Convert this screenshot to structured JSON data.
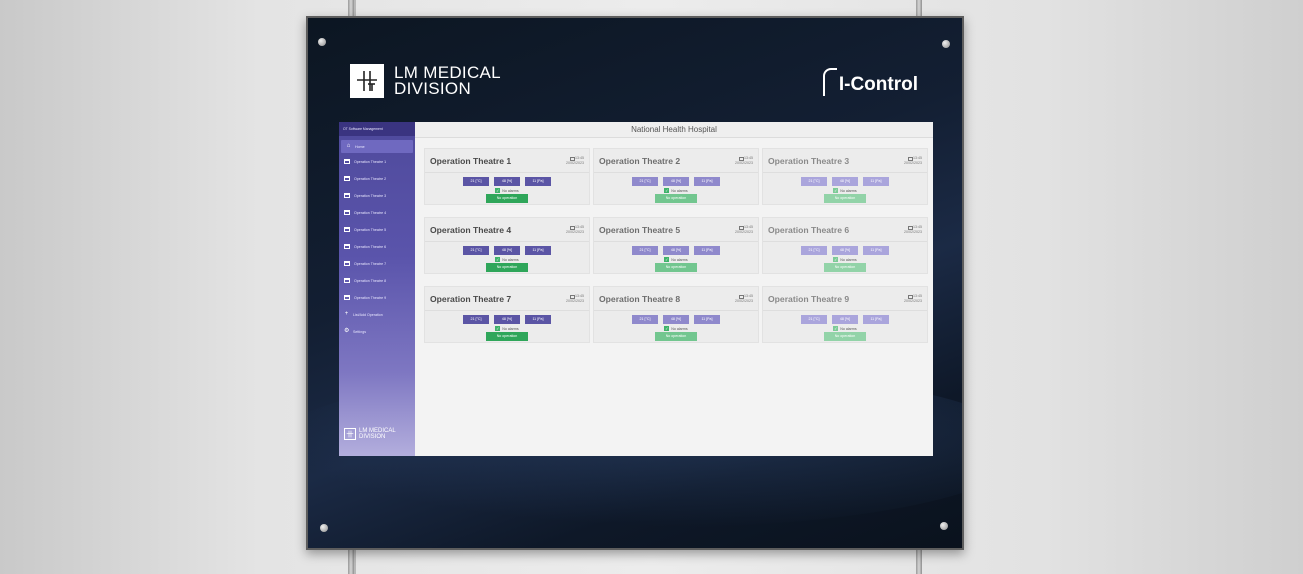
{
  "brand": {
    "line1": "LM MEDICAL",
    "line2": "DIVISION",
    "product": "I-Control"
  },
  "app": {
    "sidebar_title": "OT Software Management",
    "header_title": "National Health Hospital"
  },
  "sidebar": {
    "items": [
      {
        "label": "Home",
        "icon": "home-icon",
        "active": true
      },
      {
        "label": "Operation Theatre 1",
        "icon": "calendar-icon"
      },
      {
        "label": "Operation Theatre 2",
        "icon": "calendar-icon"
      },
      {
        "label": "Operation Theatre 3",
        "icon": "calendar-icon"
      },
      {
        "label": "Operation Theatre 4",
        "icon": "calendar-icon"
      },
      {
        "label": "Operation Theatre 5",
        "icon": "calendar-icon"
      },
      {
        "label": "Operation Theatre 6",
        "icon": "calendar-icon"
      },
      {
        "label": "Operation Theatre 7",
        "icon": "calendar-icon"
      },
      {
        "label": "Operation Theatre 8",
        "icon": "calendar-icon"
      },
      {
        "label": "Operation Theatre 9",
        "icon": "calendar-icon"
      },
      {
        "label": "List/Add Operation",
        "icon": "plus-icon"
      },
      {
        "label": "Settings",
        "icon": "gear-icon"
      }
    ],
    "logo_line1": "LM MEDICAL",
    "logo_line2": "DIVISION"
  },
  "theatres": [
    {
      "title": "Operation Theatre 1",
      "time": "13:45",
      "date": "20/02/2023",
      "temp": "21 [°C]",
      "humidity": "48 [%]",
      "pressure": "11 [Pa]",
      "alarms": "No alarms",
      "operation": "No operation"
    },
    {
      "title": "Operation Theatre 2",
      "time": "13:45",
      "date": "20/02/2023",
      "temp": "21 [°C]",
      "humidity": "48 [%]",
      "pressure": "11 [Pa]",
      "alarms": "No alarms",
      "operation": "No operation"
    },
    {
      "title": "Operation Theatre 3",
      "time": "13:45",
      "date": "20/02/2023",
      "temp": "21 [°C]",
      "humidity": "48 [%]",
      "pressure": "11 [Pa]",
      "alarms": "No alarms",
      "operation": "No operation"
    },
    {
      "title": "Operation Theatre 4",
      "time": "13:45",
      "date": "20/02/2023",
      "temp": "21 [°C]",
      "humidity": "48 [%]",
      "pressure": "11 [Pa]",
      "alarms": "No alarms",
      "operation": "No operation"
    },
    {
      "title": "Operation Theatre 5",
      "time": "13:45",
      "date": "20/02/2023",
      "temp": "21 [°C]",
      "humidity": "48 [%]",
      "pressure": "11 [Pa]",
      "alarms": "No alarms",
      "operation": "No operation"
    },
    {
      "title": "Operation Theatre 6",
      "time": "13:45",
      "date": "20/02/2023",
      "temp": "21 [°C]",
      "humidity": "48 [%]",
      "pressure": "11 [Pa]",
      "alarms": "No alarms",
      "operation": "No operation"
    },
    {
      "title": "Operation Theatre 7",
      "time": "13:45",
      "date": "20/02/2023",
      "temp": "21 [°C]",
      "humidity": "48 [%]",
      "pressure": "11 [Pa]",
      "alarms": "No alarms",
      "operation": "No operation"
    },
    {
      "title": "Operation Theatre 8",
      "time": "13:45",
      "date": "20/02/2023",
      "temp": "21 [°C]",
      "humidity": "48 [%]",
      "pressure": "11 [Pa]",
      "alarms": "No alarms",
      "operation": "No operation"
    },
    {
      "title": "Operation Theatre 9",
      "time": "13:45",
      "date": "20/02/2023",
      "temp": "21 [°C]",
      "humidity": "48 [%]",
      "pressure": "11 [Pa]",
      "alarms": "No alarms",
      "operation": "No operation"
    }
  ],
  "colors": {
    "sidebar": "#5a54ab",
    "value_chip": "#5b55a5",
    "operation_chip": "#2fa65a",
    "alarm_check": "#3fb36a"
  }
}
